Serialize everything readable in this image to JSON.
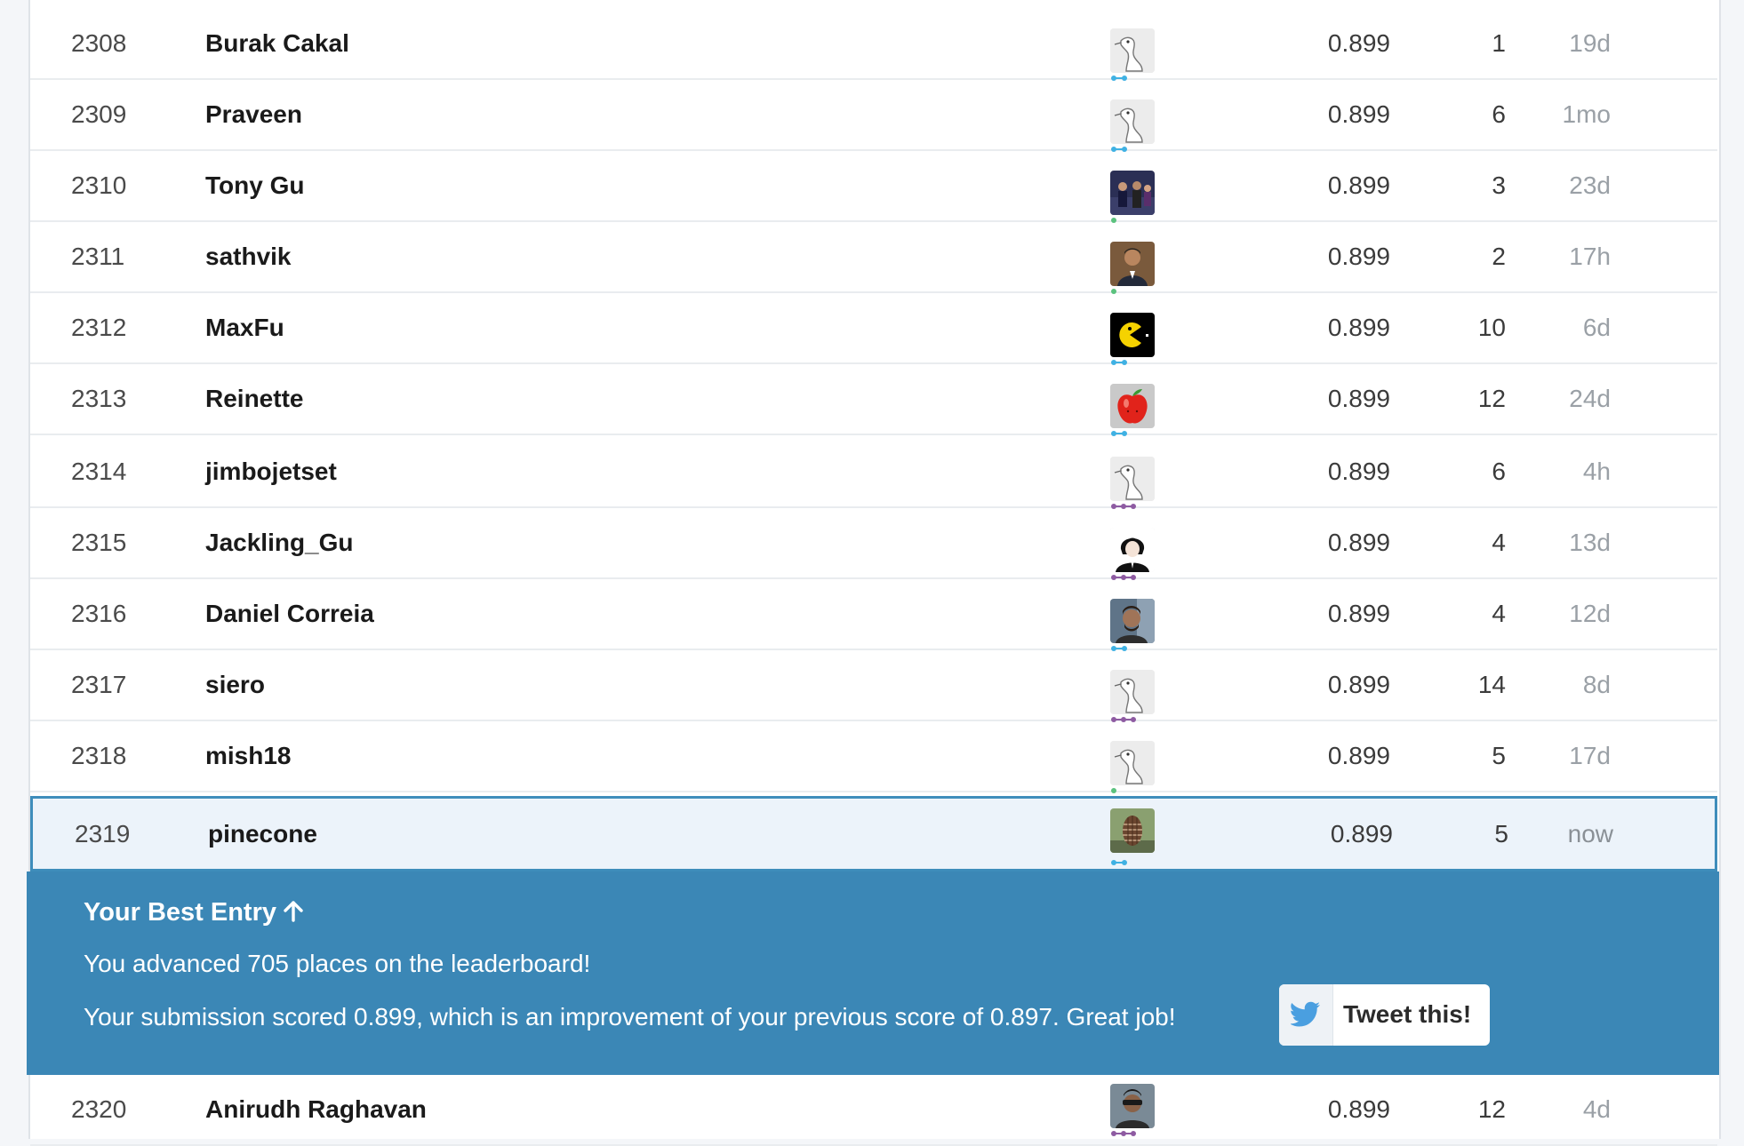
{
  "leaderboard": {
    "rows": [
      {
        "rank": "2308",
        "name": "Burak Cakal",
        "score": "0.899",
        "entries": "1",
        "last": "19d",
        "avatar": "default-avatar-icon",
        "tier": "contributor"
      },
      {
        "rank": "2309",
        "name": "Praveen",
        "score": "0.899",
        "entries": "6",
        "last": "1mo",
        "avatar": "default-avatar-icon",
        "tier": "contributor"
      },
      {
        "rank": "2310",
        "name": "Tony Gu",
        "score": "0.899",
        "entries": "3",
        "last": "23d",
        "avatar": "photo-avatar",
        "tier": "novice"
      },
      {
        "rank": "2311",
        "name": "sathvik",
        "score": "0.899",
        "entries": "2",
        "last": "17h",
        "avatar": "photo-avatar",
        "tier": "novice"
      },
      {
        "rank": "2312",
        "name": "MaxFu",
        "score": "0.899",
        "entries": "10",
        "last": "6d",
        "avatar": "pacman-avatar",
        "tier": "contributor"
      },
      {
        "rank": "2313",
        "name": "Reinette",
        "score": "0.899",
        "entries": "12",
        "last": "24d",
        "avatar": "apple-avatar",
        "tier": "contributor"
      },
      {
        "rank": "2314",
        "name": "jimbojetset",
        "score": "0.899",
        "entries": "6",
        "last": "4h",
        "avatar": "default-avatar-icon",
        "tier": "expert"
      },
      {
        "rank": "2315",
        "name": "Jackling_Gu",
        "score": "0.899",
        "entries": "4",
        "last": "13d",
        "avatar": "anime-avatar",
        "tier": "expert"
      },
      {
        "rank": "2316",
        "name": "Daniel Correia",
        "score": "0.899",
        "entries": "4",
        "last": "12d",
        "avatar": "photo-avatar",
        "tier": "contributor"
      },
      {
        "rank": "2317",
        "name": "siero",
        "score": "0.899",
        "entries": "14",
        "last": "8d",
        "avatar": "default-avatar-icon",
        "tier": "expert"
      },
      {
        "rank": "2318",
        "name": "mish18",
        "score": "0.899",
        "entries": "5",
        "last": "17d",
        "avatar": "default-avatar-icon",
        "tier": "novice"
      }
    ],
    "my_row": {
      "rank": "2319",
      "name": "pinecone",
      "score": "0.899",
      "entries": "5",
      "last": "now",
      "avatar": "pinecone-avatar",
      "tier": "contributor"
    },
    "after_row": {
      "rank": "2320",
      "name": "Anirudh Raghavan",
      "score": "0.899",
      "entries": "12",
      "last": "4d",
      "avatar": "photo-avatar",
      "tier": "expert"
    }
  },
  "banner": {
    "title": "Your Best Entry",
    "title_icon": "arrow-up-icon",
    "advanced_text": "You advanced 705 places on the leaderboard!",
    "score_text": "Your submission scored 0.899, which is an improvement of your previous score of 0.897. Great job!",
    "tweet_label": "Tweet this!",
    "tweet_icon": "twitter-bird-icon"
  },
  "colors": {
    "banner_bg": "#3b87b6",
    "highlight_border": "#3e8dbb",
    "highlight_bg": "#ecf3fa",
    "tier_novice": "#5bc27e",
    "tier_contributor": "#3fb1e3",
    "tier_expert": "#8e5ba2",
    "twitter_blue": "#4a9fe0"
  }
}
